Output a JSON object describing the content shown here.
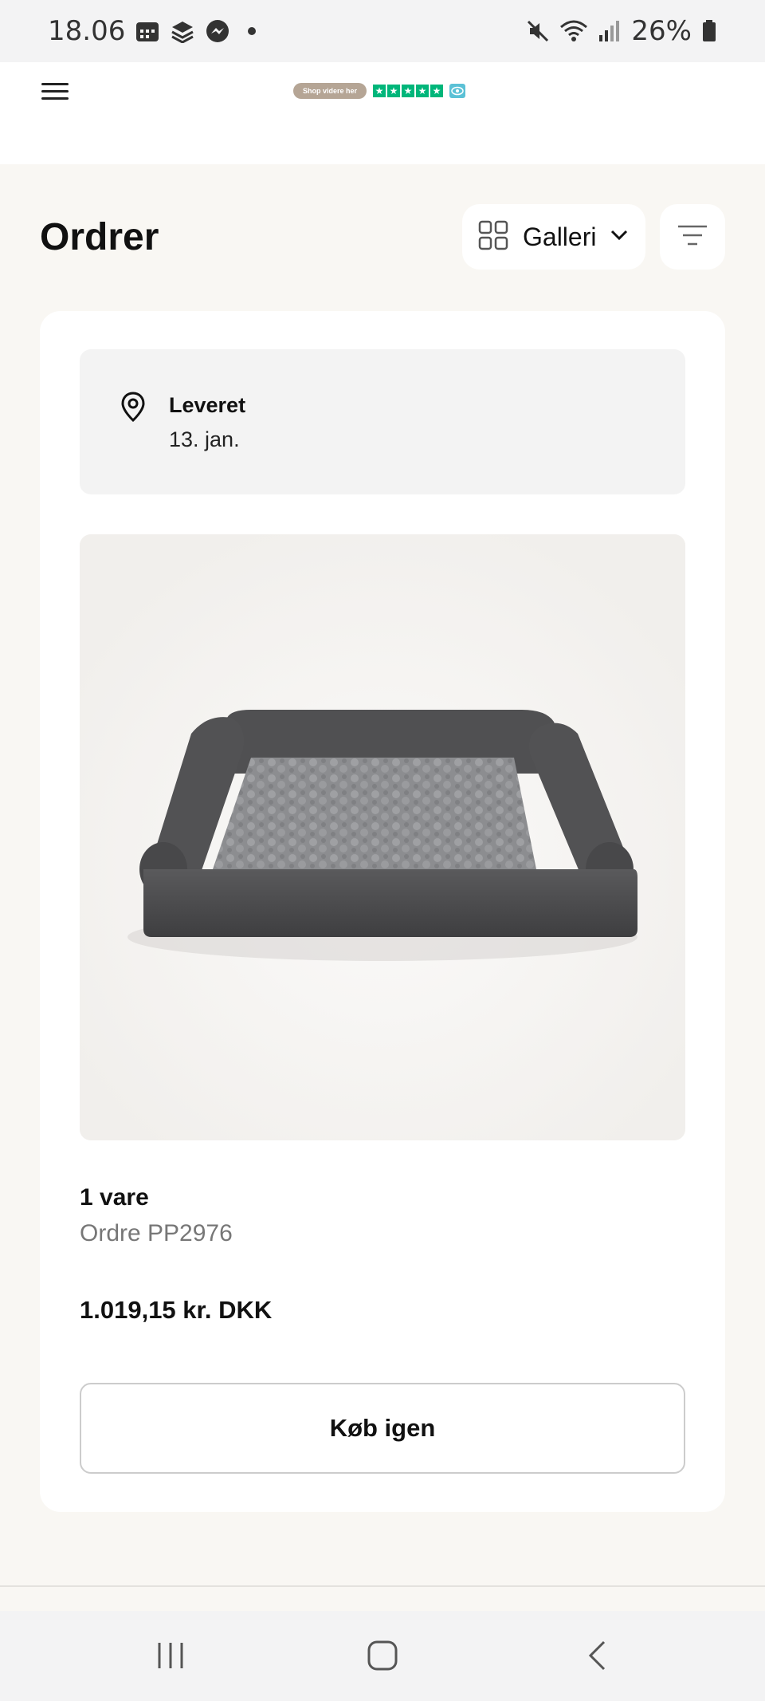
{
  "status_bar": {
    "time": "18.06",
    "battery": "26%"
  },
  "header": {
    "shop_pill": "Shop videre her",
    "stars": [
      "★",
      "★",
      "★",
      "★",
      "★"
    ]
  },
  "page": {
    "title": "Ordrer",
    "view_toggle_label": "Galleri"
  },
  "order": {
    "status_label": "Leveret",
    "status_date": "13. jan.",
    "items_count": "1 vare",
    "order_number": "Ordre PP2976",
    "total": "1.019,15 kr. DKK",
    "buy_again_label": "Køb igen"
  },
  "colors": {
    "page_bg": "#f9f7f3",
    "trustpilot_green": "#00b67a",
    "shop_pill_bg": "#b5a595"
  }
}
